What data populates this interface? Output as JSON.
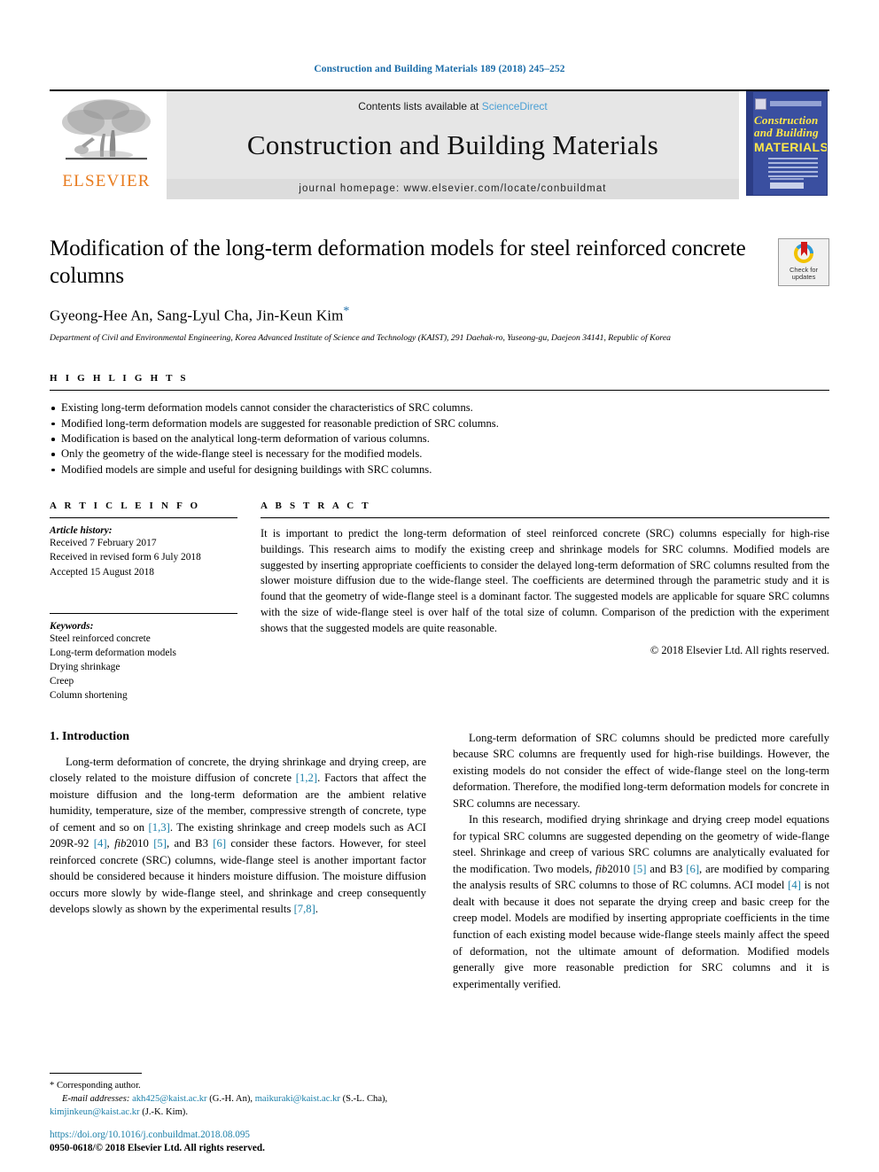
{
  "running_head": "Construction and Building Materials 189 (2018) 245–252",
  "masthead": {
    "contents_prefix": "Contents lists available at ",
    "sciencedirect": "ScienceDirect",
    "journal_title": "Construction and Building Materials",
    "homepage": "journal homepage: www.elsevier.com/locate/conbuildmat",
    "publisher_wordmark": "ELSEVIER",
    "cover": {
      "line1": "Construction",
      "line2": "and Building",
      "line3": "MATERIALS"
    }
  },
  "article": {
    "title": "Modification of the long-term deformation models for steel reinforced concrete columns",
    "authors": "Gyeong-Hee An, Sang-Lyul Cha, Jin-Keun Kim",
    "corresponding_marker": "*",
    "affiliation": "Department of Civil and Environmental Engineering, Korea Advanced Institute of Science and Technology (KAIST), 291 Daehak-ro, Yuseong-gu, Daejeon 34141, Republic of Korea",
    "crossmark": {
      "line1": "Check for",
      "line2": "updates"
    }
  },
  "highlights": {
    "label": "H I G H L I G H T S",
    "items": [
      "Existing long-term deformation models cannot consider the characteristics of SRC columns.",
      "Modified long-term deformation models are suggested for reasonable prediction of SRC columns.",
      "Modification is based on the analytical long-term deformation of various columns.",
      "Only the geometry of the wide-flange steel is necessary for the modified models.",
      "Modified models are simple and useful for designing buildings with SRC columns."
    ]
  },
  "article_info": {
    "label": "A R T I C L E   I N F O",
    "history_heading": "Article history:",
    "history": [
      "Received 7 February 2017",
      "Received in revised form 6 July 2018",
      "Accepted 15 August 2018"
    ],
    "keywords_heading": "Keywords:",
    "keywords": [
      "Steel reinforced concrete",
      "Long-term deformation models",
      "Drying shrinkage",
      "Creep",
      "Column shortening"
    ]
  },
  "abstract": {
    "label": "A B S T R A C T",
    "text": "It is important to predict the long-term deformation of steel reinforced concrete (SRC) columns especially for high-rise buildings. This research aims to modify the existing creep and shrinkage models for SRC columns. Modified models are suggested by inserting appropriate coefficients to consider the delayed long-term deformation of SRC columns resulted from the slower moisture diffusion due to the wide-flange steel. The coefficients are determined through the parametric study and it is found that the geometry of wide-flange steel is a dominant factor. The suggested models are applicable for square SRC columns with the size of wide-flange steel is over half of the total size of column. Comparison of the prediction with the experiment shows that the suggested models are quite reasonable.",
    "copyright": "© 2018 Elsevier Ltd. All rights reserved."
  },
  "introduction": {
    "heading": "1. Introduction",
    "left_para_1_a": "Long-term deformation of concrete, the drying shrinkage and drying creep, are closely related to the moisture diffusion of concrete ",
    "left_para_1_ref1": "[1,2]",
    "left_para_1_b": ". Factors that affect the moisture diffusion and the long-term deformation are the ambient relative humidity, temperature, size of the member, compressive strength of concrete, type of cement and so on ",
    "left_para_1_ref2": "[1,3]",
    "left_para_1_c": ". The existing shrinkage and creep models such as ACI 209R-92 ",
    "left_para_1_ref3": "[4]",
    "left_para_1_d": ", ",
    "left_para_1_fib": "fib",
    "left_para_1_e": "2010 ",
    "left_para_1_ref4": "[5]",
    "left_para_1_f": ", and B3 ",
    "left_para_1_ref5": "[6]",
    "left_para_1_g": " consider these factors. However, for steel reinforced concrete (SRC) columns, wide-flange steel is another important factor should be considered because it hinders moisture diffusion. The moisture diffusion occurs more slowly by wide-flange steel, and shrinkage and creep consequently develops slowly as shown by the experimental results ",
    "left_para_1_ref6": "[7,8]",
    "left_para_1_h": ".",
    "right_para_1": "Long-term deformation of SRC columns should be predicted more carefully because SRC columns are frequently used for high-rise buildings. However, the existing models do not consider the effect of wide-flange steel on the long-term deformation. Therefore, the modified long-term deformation models for concrete in SRC columns are necessary.",
    "right_para_2_a": "In this research, modified drying shrinkage and drying creep model equations for typical SRC columns are suggested depending on the geometry of wide-flange steel. Shrinkage and creep of various SRC columns are analytically evaluated for the modification. Two models, ",
    "right_para_2_fib": "fib",
    "right_para_2_b": "2010 ",
    "right_para_2_ref1": "[5]",
    "right_para_2_c": " and B3 ",
    "right_para_2_ref2": "[6]",
    "right_para_2_d": ", are modified by comparing the analysis results of SRC columns to those of RC columns. ACI model ",
    "right_para_2_ref3": "[4]",
    "right_para_2_e": " is not dealt with because it does not separate the drying creep and basic creep for the creep model. Models are modified by inserting appropriate coefficients in the time function of each existing model because wide-flange steels mainly affect the speed of deformation, not the ultimate amount of deformation. Modified models generally give more reasonable prediction for SRC columns and it is experimentally verified."
  },
  "footnote": {
    "corresponding_star": "*",
    "corresponding_text": " Corresponding author.",
    "email_label": "E-mail addresses:",
    "email1": "akh425@kaist.ac.kr",
    "email1_owner": " (G.-H. An), ",
    "email2": "maikuraki@kaist.ac.kr",
    "email2_owner": " (S.-L. Cha), ",
    "email3": "kimjinkeun@kaist.ac.kr",
    "email3_owner": " (J.-K. Kim)."
  },
  "colophon": {
    "doi": "https://doi.org/10.1016/j.conbuildmat.2018.08.095",
    "issn": "0950-0618/© 2018 Elsevier Ltd. All rights reserved."
  },
  "colors": {
    "link_blue": "#1b7fa8",
    "running_head_blue": "#1b6ca8",
    "elsevier_orange": "#e87b1e",
    "sciencedirect_blue": "#4a9fd4",
    "cover_blue": "#3a4fa0",
    "cover_yellow": "#ffe84a"
  }
}
